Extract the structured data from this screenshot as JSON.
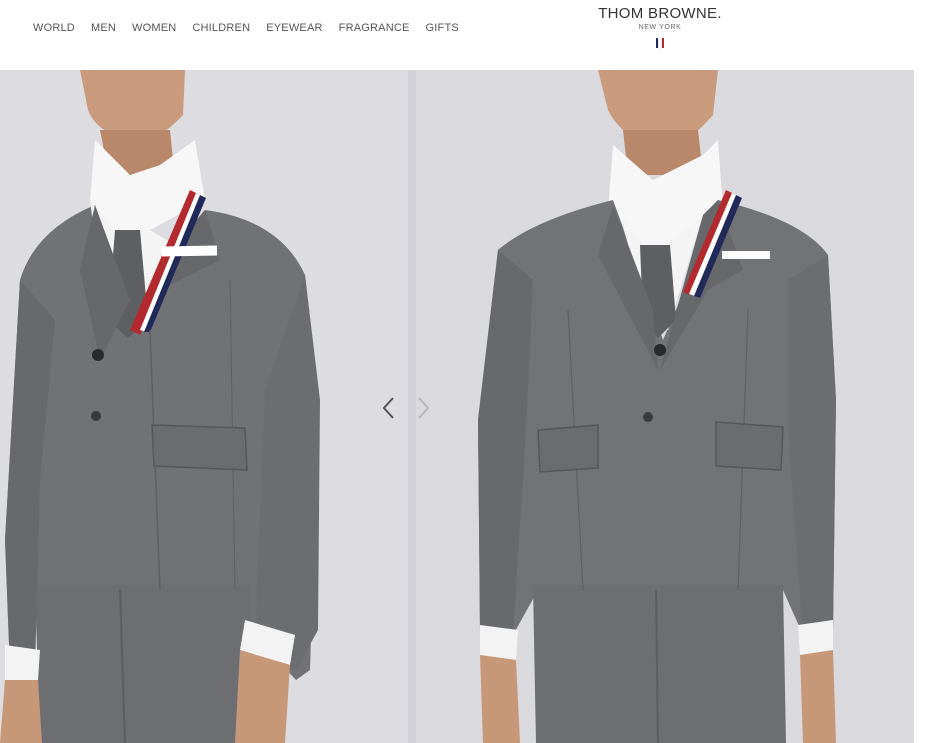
{
  "nav": {
    "items": [
      {
        "label": "WORLD"
      },
      {
        "label": "MEN"
      },
      {
        "label": "WOMEN"
      },
      {
        "label": "CHILDREN"
      },
      {
        "label": "EYEWEAR"
      },
      {
        "label": "FRAGRANCE"
      },
      {
        "label": "GIFTS"
      }
    ]
  },
  "brand": {
    "name": "THOM BROWNE.",
    "sub": "NEW YORK",
    "flag_colors": [
      "#1f2a5a",
      "#ffffff",
      "#b22a2e"
    ]
  },
  "gallery": {
    "prev_icon": "chevron-left-icon",
    "next_icon": "chevron-right-icon",
    "images": [
      {
        "description_icon": "suit-front-angle-image"
      },
      {
        "description_icon": "suit-front-image"
      }
    ]
  },
  "colors": {
    "background": "#d9d9de",
    "suit": "#707276",
    "stripe_red": "#b22a2e",
    "stripe_navy": "#1f2a5a"
  }
}
